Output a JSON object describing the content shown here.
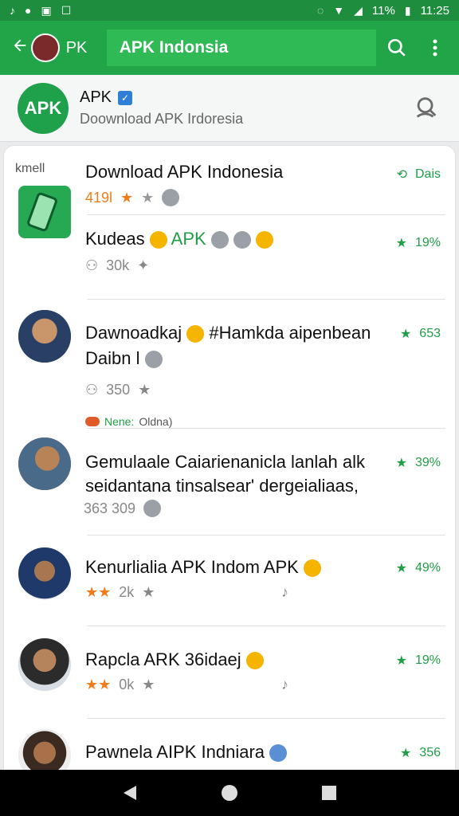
{
  "status": {
    "battery": "11%",
    "time": "11:25"
  },
  "appbar": {
    "short": "PK",
    "search_text": "APK Indonsia"
  },
  "header": {
    "logo_text": "APK",
    "title": "APK",
    "subtitle": "Doownload APK Irdoresia"
  },
  "list": {
    "first_label": "kmell",
    "items": [
      {
        "title": "Download APK Indonesia",
        "meta": "419l",
        "stat": "Dais"
      },
      {
        "title": "Kudeas",
        "title_extra": "APK",
        "meta": "30k",
        "stat": "19%"
      },
      {
        "title": "Dawnoadkaj",
        "title_extra": "#Hamkda aipenbean",
        "line2": "Daibn l",
        "meta": "350",
        "stat": "653",
        "badge_a": "Nene:",
        "badge_b": "Oldna)"
      },
      {
        "title": "Gemulaale Caiarienanicla lanlah alk",
        "line2": "seidantana tinsalsear' dergeialiaas,",
        "meta": "363 309",
        "stat": "39%"
      },
      {
        "title": "Kenurlialia APK Indom APK",
        "meta": "2k",
        "stat": "49%"
      },
      {
        "title": "Rapcla ARK 36idaej",
        "meta": "0k",
        "stat": "19%"
      },
      {
        "title": "Pawnela AIPK Indniara",
        "meta": "",
        "stat": "356"
      }
    ]
  },
  "colors": {
    "primary": "#22a548",
    "primary_dark": "#1e8e3e",
    "accent": "#f07d1a"
  }
}
